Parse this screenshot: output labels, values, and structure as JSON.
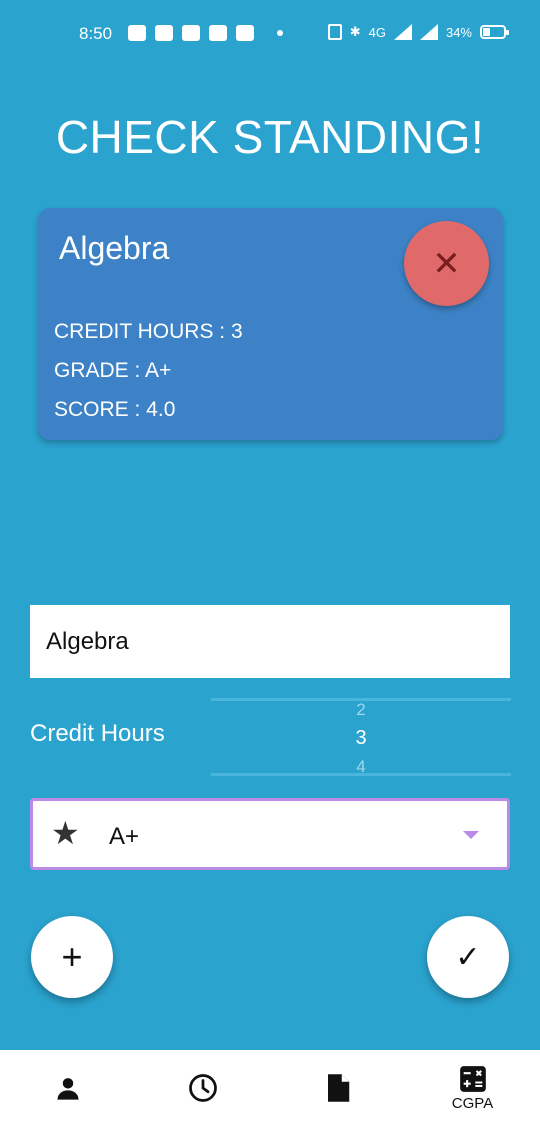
{
  "status_bar": {
    "time": "8:50",
    "battery_text": "34%",
    "network_text": "4G",
    "icons": [
      "notification-icon",
      "youtube-icon",
      "linkedin-icon",
      "gmail-icon",
      "app-icon",
      "dot-icon",
      "vibrate-icon",
      "bluetooth-icon",
      "signal-icon",
      "battery-icon"
    ]
  },
  "title": "CHECK STANDING!",
  "course_card": {
    "name": "Algebra",
    "credit_hours": "CREDIT HOURS : 3",
    "grade": "GRADE : A+",
    "score": "SCORE : 4.0",
    "remove_icon": "close-icon",
    "remove_glyph": "✕"
  },
  "form": {
    "course_name_value": "Algebra",
    "credit_label": "Credit Hours",
    "credit_picker": {
      "prev": "2",
      "current": "3",
      "next": "4"
    },
    "grade_value": "A+",
    "grade_icon": "star-icon",
    "star_glyph": "★"
  },
  "fabs": {
    "add_glyph": "+",
    "done_glyph": "✓"
  },
  "bottom_nav": {
    "items": [
      {
        "icon": "person-icon",
        "label": ""
      },
      {
        "icon": "clock-icon",
        "label": ""
      },
      {
        "icon": "document-icon",
        "label": ""
      },
      {
        "icon": "calculator-icon",
        "label": "CGPA"
      }
    ]
  },
  "colors": {
    "background": "#2aa3cf",
    "card": "#3d82c6",
    "remove_button": "#e06a6a",
    "select_border": "#b98be6"
  }
}
